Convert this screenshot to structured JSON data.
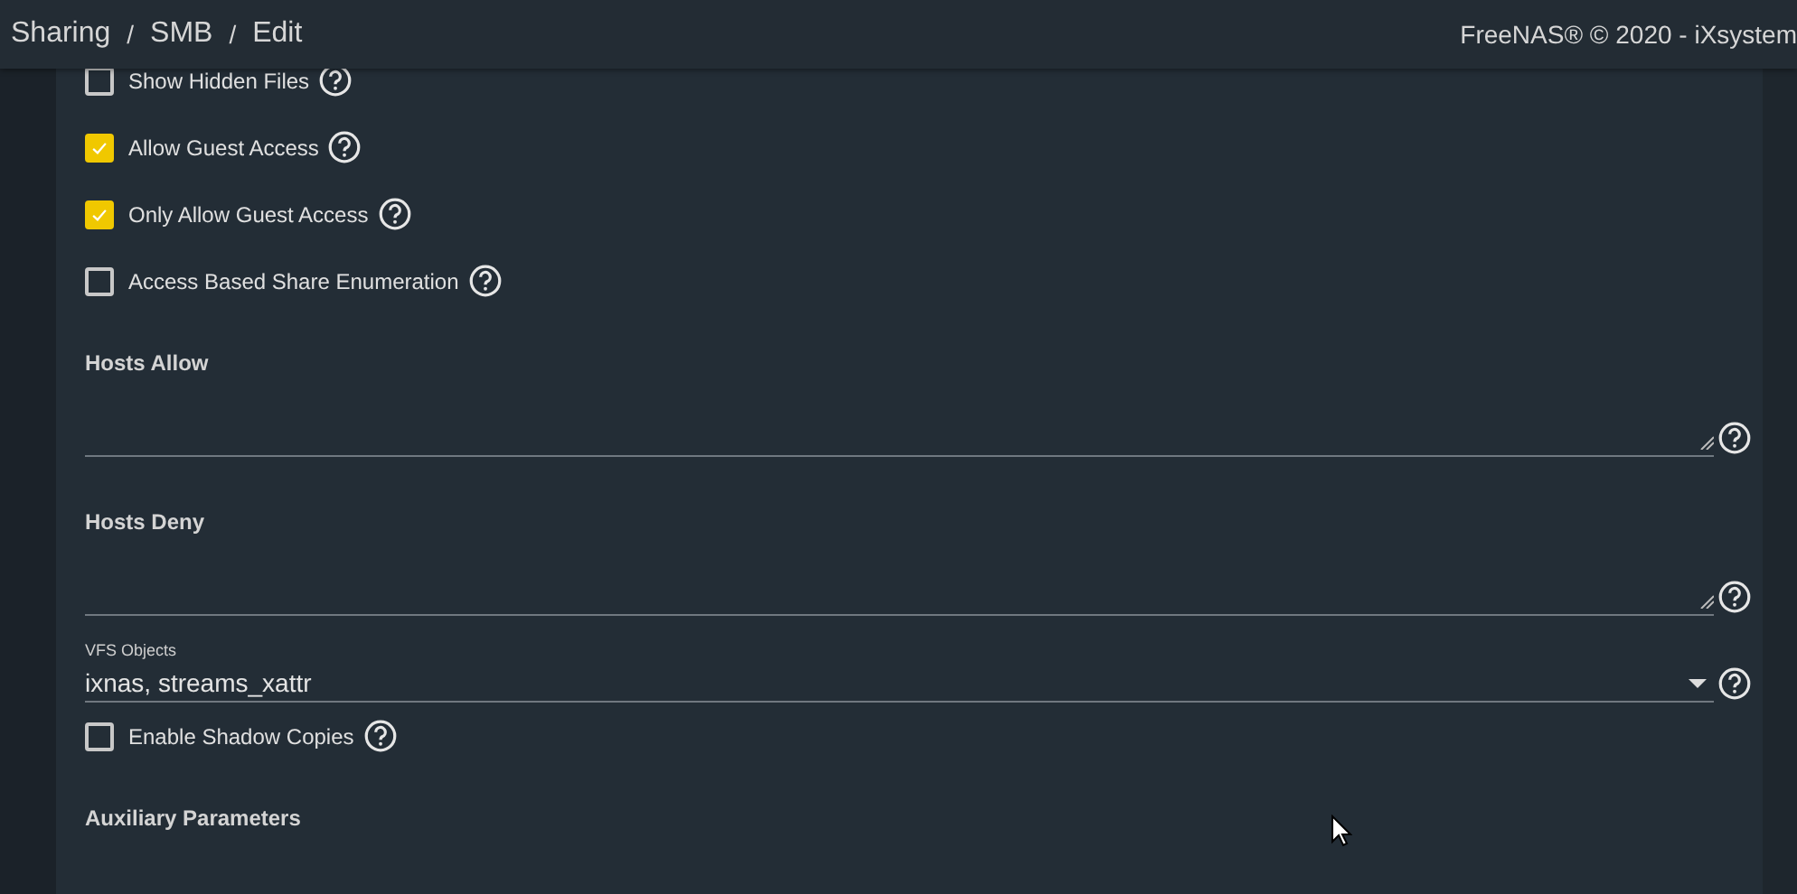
{
  "header": {
    "breadcrumb": [
      "Sharing",
      "SMB",
      "Edit"
    ],
    "separator": "/",
    "copyright": "FreeNAS® © 2020 - iXsystem"
  },
  "fields": [
    {
      "kind": "checkbox",
      "label": "Show Hidden Files",
      "checked": false
    },
    {
      "kind": "checkbox",
      "label": "Allow Guest Access",
      "checked": true
    },
    {
      "kind": "checkbox",
      "label": "Only Allow Guest Access",
      "checked": true
    },
    {
      "kind": "checkbox",
      "label": "Access Based Share Enumeration",
      "checked": false
    },
    {
      "kind": "textarea",
      "label": "Hosts Allow"
    },
    {
      "kind": "textarea",
      "label": "Hosts Deny"
    },
    {
      "kind": "select",
      "label": "VFS Objects",
      "value": "ixnas, streams_xattr"
    },
    {
      "kind": "checkbox",
      "label": "Enable Shadow Copies",
      "checked": false
    },
    {
      "kind": "heading",
      "label": "Auxiliary Parameters"
    }
  ]
}
